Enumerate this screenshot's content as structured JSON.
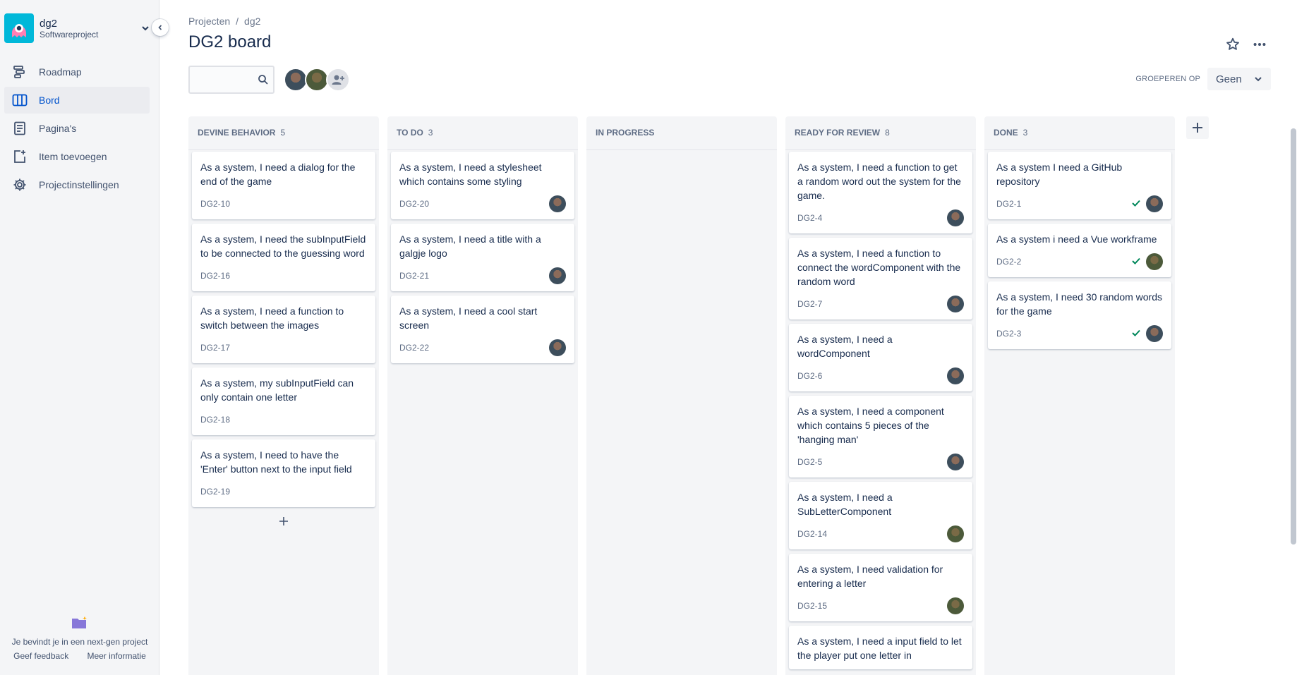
{
  "sidebar": {
    "project_name": "dg2",
    "project_type": "Softwareproject",
    "items": [
      {
        "label": "Roadmap",
        "icon": "roadmap-icon",
        "active": false
      },
      {
        "label": "Bord",
        "icon": "board-icon",
        "active": true
      },
      {
        "label": "Pagina's",
        "icon": "pages-icon",
        "active": false
      },
      {
        "label": "Item toevoegen",
        "icon": "add-item-icon",
        "active": false
      },
      {
        "label": "Projectinstellingen",
        "icon": "gear-icon",
        "active": false
      }
    ],
    "footer_text": "Je bevindt je in een next-gen project",
    "feedback_link": "Geef feedback",
    "info_link": "Meer informatie"
  },
  "breadcrumb": [
    "Projecten",
    "/",
    "dg2"
  ],
  "page_title": "DG2 board",
  "group_by": {
    "label": "GROEPEREN OP",
    "value": "Geen"
  },
  "columns": [
    {
      "name": "DEVINE BEHAVIOR",
      "count": "5",
      "cards": [
        {
          "title": "As a system, I need a dialog for the end of the game",
          "key": "DG2-10",
          "avatar": "",
          "done": false
        },
        {
          "title": "As a system, I need the subInputField to be connected to the guessing word",
          "key": "DG2-16",
          "avatar": "",
          "done": false
        },
        {
          "title": "As a system, I need a function to switch between the images",
          "key": "DG2-17",
          "avatar": "",
          "done": false
        },
        {
          "title": "As a system, my subInputField can only contain one letter",
          "key": "DG2-18",
          "avatar": "",
          "done": false
        },
        {
          "title": "As a system, I need to have the 'Enter' button next to the input field",
          "key": "DG2-19",
          "avatar": "",
          "done": false
        }
      ]
    },
    {
      "name": "TO DO",
      "count": "3",
      "cards": [
        {
          "title": "As a system, I need a stylesheet which contains some styling",
          "key": "DG2-20",
          "avatar": "av1",
          "done": false
        },
        {
          "title": "As a system, I need a title with a galgje logo",
          "key": "DG2-21",
          "avatar": "av1",
          "done": false
        },
        {
          "title": "As a system, I need a cool start screen",
          "key": "DG2-22",
          "avatar": "av1",
          "done": false
        }
      ]
    },
    {
      "name": "IN PROGRESS",
      "count": "",
      "cards": []
    },
    {
      "name": "READY FOR REVIEW",
      "count": "8",
      "cards": [
        {
          "title": "As a system, I need a function to get a random word out the system for the game.",
          "key": "DG2-4",
          "avatar": "av1",
          "done": false
        },
        {
          "title": "As a system, I need a function to connect the wordComponent with the random word",
          "key": "DG2-7",
          "avatar": "av1",
          "done": false
        },
        {
          "title": "As a system, I need a wordComponent",
          "key": "DG2-6",
          "avatar": "av1",
          "done": false
        },
        {
          "title": "As a system, I need a component which contains 5 pieces of the 'hanging man'",
          "key": "DG2-5",
          "avatar": "av1",
          "done": false
        },
        {
          "title": "As a system, I need a SubLetterComponent",
          "key": "DG2-14",
          "avatar": "av2",
          "done": false
        },
        {
          "title": "As a system, I need validation for entering a letter",
          "key": "DG2-15",
          "avatar": "av2",
          "done": false
        },
        {
          "title": "As a system, I need a input field to let the player put one letter in",
          "key": "",
          "avatar": "",
          "done": false
        }
      ]
    },
    {
      "name": "DONE",
      "count": "3",
      "cards": [
        {
          "title": "As a system I need a GitHub repository",
          "key": "DG2-1",
          "avatar": "av1",
          "done": true
        },
        {
          "title": "As a system i need a Vue workframe",
          "key": "DG2-2",
          "avatar": "av2",
          "done": true
        },
        {
          "title": "As a system, I need 30 random words for the game",
          "key": "DG2-3",
          "avatar": "av1",
          "done": true
        }
      ]
    }
  ],
  "colors": {
    "accent": "#0052cc",
    "sidebar_bg": "#f4f5f7",
    "column_bg": "#f4f5f7",
    "done_check": "#00875a"
  }
}
